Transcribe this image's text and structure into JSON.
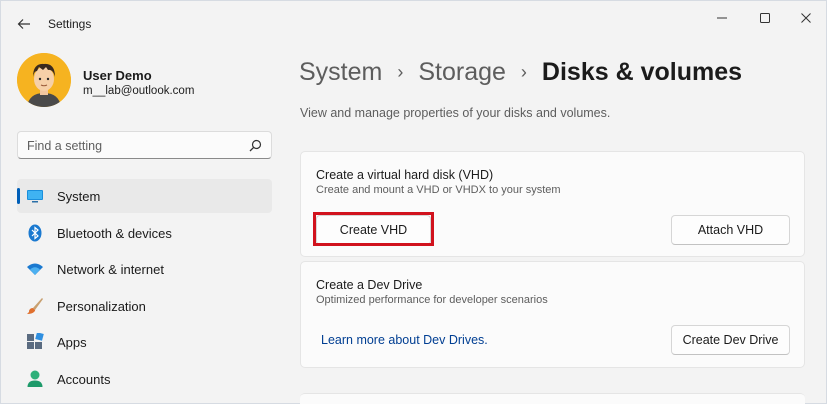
{
  "window": {
    "title": "Settings"
  },
  "profile": {
    "name": "User Demo",
    "email": "m__lab@outlook.com"
  },
  "search": {
    "placeholder": "Find a setting"
  },
  "sidebar": {
    "items": [
      {
        "label": "System",
        "icon": "monitor-icon",
        "active": true
      },
      {
        "label": "Bluetooth & devices",
        "icon": "bluetooth-icon",
        "active": false
      },
      {
        "label": "Network & internet",
        "icon": "wifi-icon",
        "active": false
      },
      {
        "label": "Personalization",
        "icon": "brush-icon",
        "active": false
      },
      {
        "label": "Apps",
        "icon": "apps-icon",
        "active": false
      },
      {
        "label": "Accounts",
        "icon": "person-icon",
        "active": false
      }
    ]
  },
  "breadcrumb": {
    "items": [
      "System",
      "Storage"
    ],
    "current": "Disks & volumes",
    "separator": "›"
  },
  "main": {
    "description": "View and manage properties of your disks and volumes.",
    "vhd_card": {
      "title": "Create a virtual hard disk (VHD)",
      "subtitle": "Create and mount a VHD or VHDX to your system",
      "create_label": "Create VHD",
      "attach_label": "Attach VHD"
    },
    "dev_card": {
      "title": "Create a Dev Drive",
      "subtitle": "Optimized performance for developer scenarios",
      "link_label": "Learn more about Dev Drives.",
      "create_label": "Create Dev Drive"
    }
  },
  "colors": {
    "accent": "#005fb8",
    "highlight": "#d1121d",
    "link": "#003e92"
  }
}
